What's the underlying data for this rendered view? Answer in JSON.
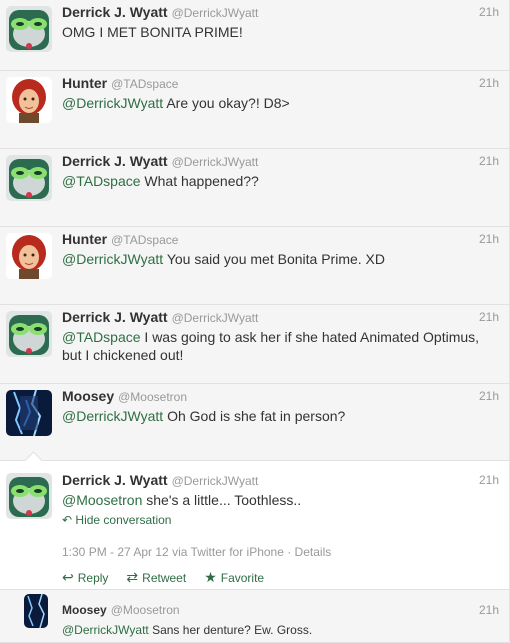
{
  "tweets": [
    {
      "name": "Derrick J. Wyatt",
      "handle": "@DerrickJWyatt",
      "time": "21h",
      "mention": "",
      "text": "OMG I MET BONITA PRIME!"
    },
    {
      "name": "Hunter",
      "handle": "@TADspace",
      "time": "21h",
      "mention": "@DerrickJWyatt",
      "text": " Are you okay?! D8>"
    },
    {
      "name": "Derrick J. Wyatt",
      "handle": "@DerrickJWyatt",
      "time": "21h",
      "mention": "@TADspace",
      "text": " What happened??"
    },
    {
      "name": "Hunter",
      "handle": "@TADspace",
      "time": "21h",
      "mention": "@DerrickJWyatt",
      "text": " You said you met Bonita Prime. XD"
    },
    {
      "name": "Derrick J. Wyatt",
      "handle": "@DerrickJWyatt",
      "time": "21h",
      "mention": "@TADspace",
      "text": " I was going to ask her if she hated Animated Optimus, but I chickened out!"
    },
    {
      "name": "Moosey",
      "handle": "@Moosetron",
      "time": "21h",
      "mention": "@DerrickJWyatt",
      "text": " Oh God is she fat in person?"
    }
  ],
  "open_tweet": {
    "name": "Derrick J. Wyatt",
    "handle": "@DerrickJWyatt",
    "time": "21h",
    "mention": "@Moosetron",
    "text": " she's a little... Toothless..",
    "hide_label": "Hide conversation",
    "meta": "1:30 PM - 27 Apr 12 via Twitter for iPhone · Details",
    "reply": "Reply",
    "retweet": "Retweet",
    "favorite": "Favorite"
  },
  "reply_tweet": {
    "name": "Moosey",
    "handle": "@Moosetron",
    "time": "21h",
    "mention": "@DerrickJWyatt",
    "text": " Sans her denture? Ew. Gross."
  },
  "colors": {
    "link": "#2f6e44",
    "muted": "#999999",
    "text": "#333333"
  }
}
